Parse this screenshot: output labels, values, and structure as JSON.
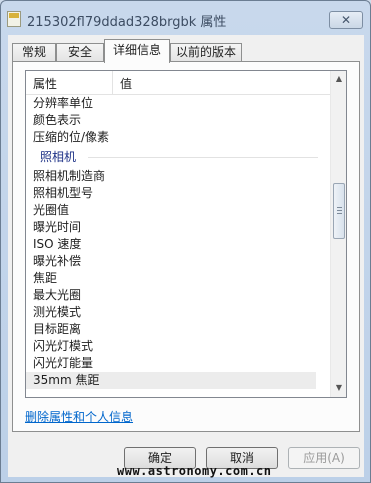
{
  "window": {
    "title": "215302fl79ddad328brgbk 属性",
    "close_glyph": "✕"
  },
  "tabs": [
    {
      "label": "常规"
    },
    {
      "label": "安全"
    },
    {
      "label": "详细信息",
      "active": true
    },
    {
      "label": "以前的版本"
    }
  ],
  "properties": {
    "column_headers": {
      "property": "属性",
      "value": "值"
    },
    "rows_before_group": [
      "分辨率单位",
      "颜色表示",
      "压缩的位/像素"
    ],
    "group_label": "照相机",
    "rows_after_group": [
      "照相机制造商",
      "照相机型号",
      "光圈值",
      "曝光时间",
      "ISO 速度",
      "曝光补偿",
      "焦距",
      "最大光圈",
      "测光模式",
      "目标距离",
      "闪光灯模式",
      "闪光灯能量",
      "35mm 焦距"
    ]
  },
  "links": {
    "remove_properties": "删除属性和个人信息"
  },
  "buttons": {
    "ok": "确定",
    "cancel": "取消",
    "apply": "应用(A)"
  },
  "scrollbar": {
    "up_glyph": "▲",
    "down_glyph": "▼"
  },
  "watermark": "www.astronomy.com.cn"
}
